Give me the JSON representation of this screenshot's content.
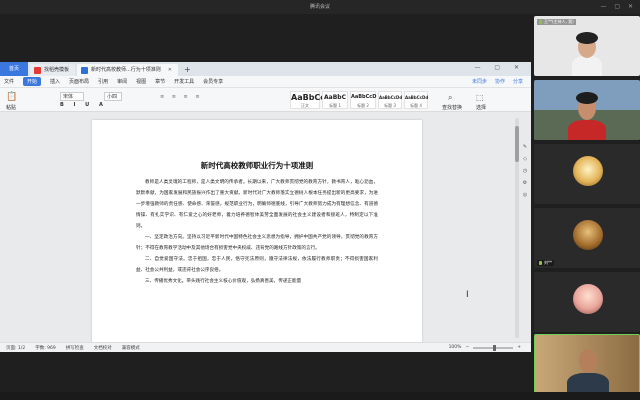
{
  "meeting": {
    "title": "腾讯会议"
  },
  "wps": {
    "tabs": [
      {
        "label": "首页"
      },
      {
        "label": "找稻壳模板"
      },
      {
        "label": "新时代高校教师...行为十项准则"
      }
    ],
    "menus": [
      "文件",
      "开始",
      "插入",
      "页面布局",
      "引用",
      "审阅",
      "视图",
      "章节",
      "开发工具",
      "会员专享"
    ],
    "menu_right": [
      "未同步",
      "协作",
      "分享"
    ],
    "ribbon": {
      "paste": "粘贴",
      "font_name": "宋体",
      "font_size": "小四",
      "styles": [
        {
          "sample": "AaBbCcDd",
          "caption": "正文"
        },
        {
          "sample": "AaBbC",
          "caption": "标题 1"
        },
        {
          "sample": "AaBbCcD",
          "caption": "标题 2"
        },
        {
          "sample": "AaBbCcDd",
          "caption": "标题 3"
        },
        {
          "sample": "AaBbCcDd",
          "caption": "标题 4"
        }
      ],
      "find_replace": "查找替换",
      "select": "选择"
    },
    "document": {
      "title": "新时代高校教师职业行为十项准则",
      "paragraphs": [
        "教师是人类灵魂的工程师，是人类文明的传承者。长期以来，广大教师贯彻党的教育方针，教书育人，呕心沥血，默默奉献，为国家发展和民族振兴作出了重大贡献。新时代对广大教师落实立德树人根本任务提出新的更高要求，为进一步增强教师的责任感、使命感、荣誉感，规范职业行为，明确师德底线，引导广大教师努力成为有理想信念、有道德情操、有扎实学识、有仁爱之心的好老师，着力培养德智体美劳全面发展的社会主义建设者和接班人，特制定以下准则。",
        "一、坚定政治方向。坚持以习近平新时代中国特色社会主义思想为指导，拥护中国共产党的领导，贯彻党的教育方针；不得在教育教学活动中及其他场合有损害党中央权威、违背党的路线方针政策的言行。",
        "二、自觉爱国守法。忠于祖国，忠于人民，恪守宪法原则，遵守法律法规，依法履行教师职责；不得损害国家利益、社会公共利益，或违背社会公序良俗。",
        "三、传播优秀文化。带头践行社会主义核心价值观，弘扬真善美，传递正能量"
      ]
    },
    "status": {
      "page": "页面: 1/2",
      "words": "字数: 969",
      "spell": "拼写检查",
      "proof": "文档校对",
      "mode": "兼容模式",
      "zoom": "100%"
    }
  },
  "participants": [
    {
      "name": "王**(主持人, 我)",
      "bg": "#e7e7e7"
    },
    {
      "name": "",
      "bg": "#7f9dbc"
    },
    {
      "name": "",
      "bg": "#2a2a2a"
    },
    {
      "name": "刘**",
      "bg": "#2a2a2a"
    },
    {
      "name": "",
      "bg": "#2a2a2a"
    },
    {
      "name": "",
      "bg": "#b0895c"
    }
  ]
}
